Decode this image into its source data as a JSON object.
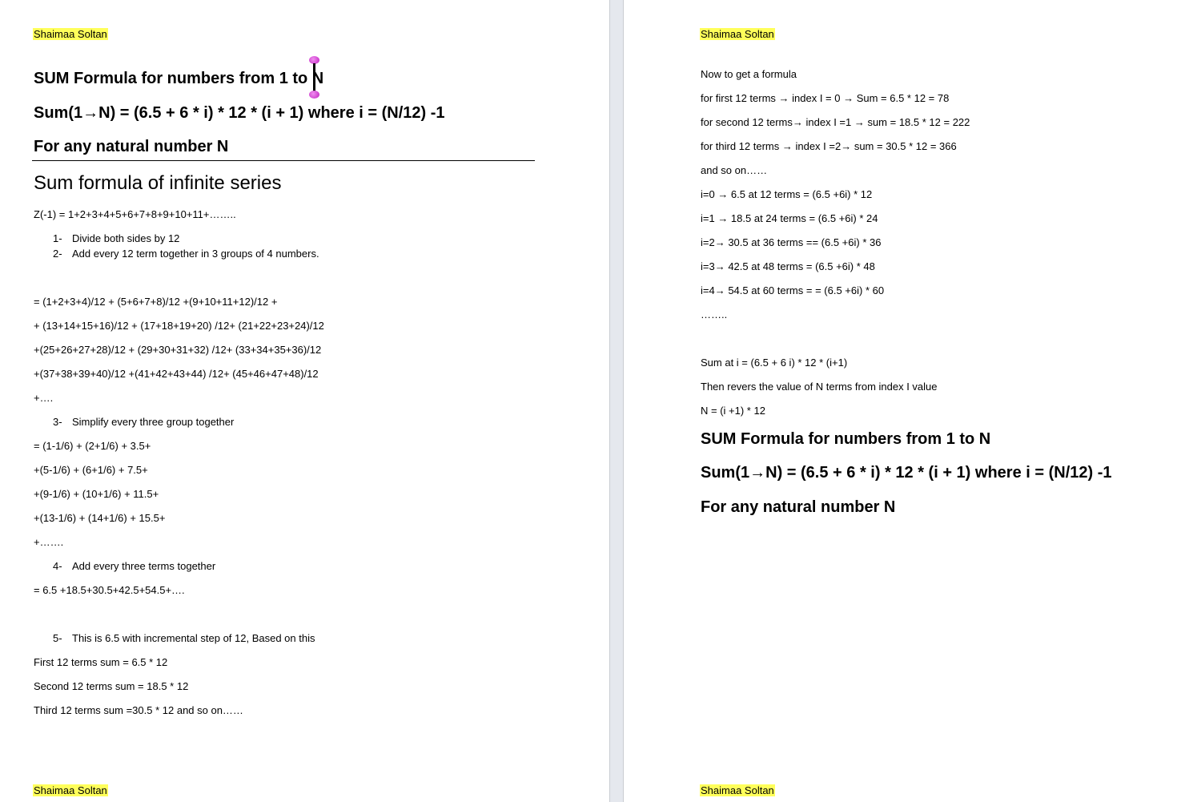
{
  "author": "Shaimaa Soltan",
  "left": {
    "title1": "SUM Formula for numbers from 1 to N",
    "formula": "Sum(1→N) = (6.5 + 6 * i) * 12 * (i + 1) where i = (N/12) -1",
    "natural": "For any natural number N",
    "section": "Sum formula of infinite series",
    "z_line": "Z(-1)  = 1+2+3+4+5+6+7+8+9+10+11+……..",
    "steps": [
      {
        "num": "1-",
        "text": "Divide both sides by 12"
      },
      {
        "num": "2-",
        "text": "Add every 12 term together in 3 groups of 4 numbers."
      }
    ],
    "groups": [
      "= (1+2+3+4)/12 + (5+6+7+8)/12 +(9+10+11+12)/12 +",
      "+ (13+14+15+16)/12 + (17+18+19+20) /12+ (21+22+23+24)/12",
      "+(25+26+27+28)/12 + (29+30+31+32) /12+ (33+34+35+36)/12",
      "+(37+38+39+40)/12 +(41+42+43+44) /12+ (45+46+47+48)/12",
      "+…."
    ],
    "step3": {
      "num": "3-",
      "text": "Simplify every three group together"
    },
    "simplified": [
      "= (1-1/6) + (2+1/6) + 3.5+",
      "+(5-1/6) + (6+1/6) + 7.5+",
      "+(9-1/6) + (10+1/6) + 11.5+",
      "+(13-1/6) + (14+1/6) + 15.5+",
      "+……."
    ],
    "step4": {
      "num": "4-",
      "text": "Add every three terms together"
    },
    "added": "= 6.5 +18.5+30.5+42.5+54.5+….",
    "step5": {
      "num": "5-",
      "text": "This is 6.5 with incremental step of 12, Based on this"
    },
    "terms": [
      "First 12 terms sum = 6.5 * 12",
      "Second 12 terms sum = 18.5 * 12",
      "Third 12 terms sum =30.5 * 12 and so on……"
    ]
  },
  "right": {
    "lines": [
      "Now to get a formula",
      "for first 12 terms →  index I = 0 → Sum = 6.5 * 12 = 78",
      "for second 12 terms→ index I =1 → sum = 18.5 * 12 = 222",
      "for third 12 terms → index I =2→ sum = 30.5 * 12 = 366",
      "and so on……",
      "i=0 → 6.5 at 12 terms = (6.5 +6i) * 12",
      "i=1 → 18.5 at 24 terms = (6.5 +6i) * 24",
      "i=2→ 30.5 at 36 terms == (6.5 +6i) * 36",
      "i=3→ 42.5 at 48 terms = (6.5 +6i) * 48",
      "i=4→ 54.5 at 60 terms = = (6.5 +6i) * 60",
      "……..",
      "Sum at i = (6.5 + 6 i) * 12 * (i+1)",
      "Then revers the value of N terms from index I value",
      "N = (i +1) * 12"
    ],
    "title1": "SUM Formula for numbers from 1 to N",
    "formula": "Sum(1→N) = (6.5 + 6 * i) * 12 * (i + 1) where i = (N/12) -1",
    "natural": "For any natural number N"
  }
}
